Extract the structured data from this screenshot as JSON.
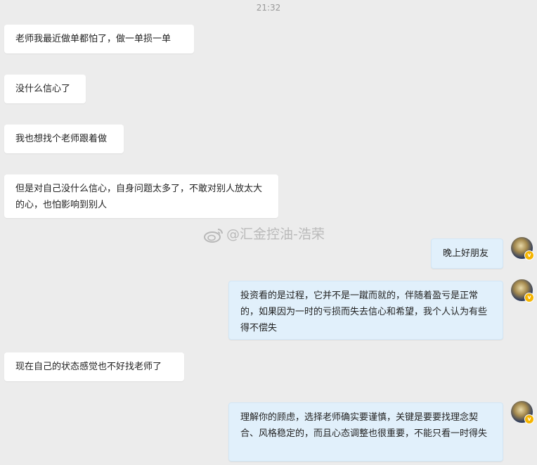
{
  "timestamp": "21:32",
  "watermark": "@汇金控油-浩荣",
  "messages": [
    {
      "side": "in",
      "text": "老师我最近做单都怕了，做一单损一单"
    },
    {
      "side": "in",
      "text": "没什么信心了"
    },
    {
      "side": "in",
      "text": "我也想找个老师跟着做"
    },
    {
      "side": "in",
      "text": "但是对自己没什么信心，自身问题太多了，不敢对别人放太大的心，也怕影响到别人"
    },
    {
      "side": "out",
      "text": "晚上好朋友"
    },
    {
      "side": "out",
      "text": "投资看的是过程，它并不是一蹴而就的，伴随着盈亏是正常的，如果因为一时的亏损而失去信心和希望，我个人认为有些得不偿失"
    },
    {
      "side": "in",
      "text": "现在自己的状态感觉也不好找老师了"
    },
    {
      "side": "out",
      "text": "理解你的顾虑，选择老师确实要谨慎，关键是要要找理念契合、风格稳定的，而且心态调整也很重要，不能只看一时得失"
    }
  ],
  "verified_badge_icon": "v-badge-icon",
  "colors": {
    "incoming_bubble": "#ffffff",
    "outgoing_bubble": "#e1f0fb",
    "background": "#ececec"
  }
}
